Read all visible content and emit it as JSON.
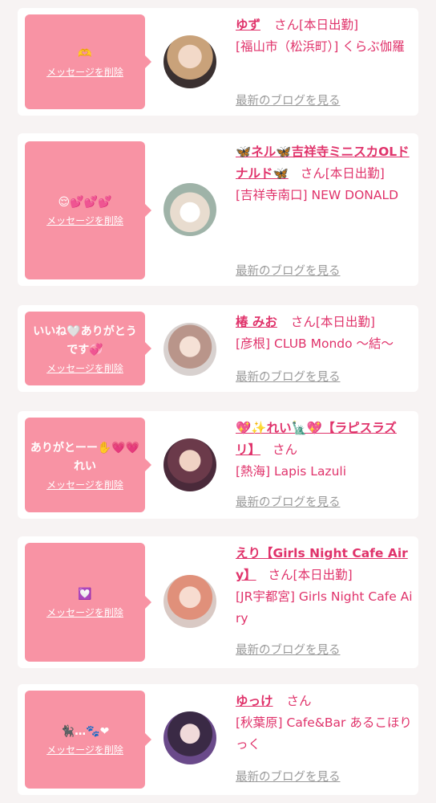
{
  "delete_label": "メッセージを削除",
  "blog_label": "最新のブログを見る",
  "items": [
    {
      "message": "🫶",
      "name": "ゆず",
      "suffix": "さん[本日出勤]",
      "shop": "[福山市（松浜町）] くらぶ伽羅"
    },
    {
      "message": "😌💕💕💕",
      "name": "🦋ネル🦋吉祥寺ミニスカOLドナルド🦋",
      "suffix": "さん[本日出勤]",
      "shop": "[吉祥寺南口] NEW DONALD"
    },
    {
      "message": "いいね🤍ありがとうです💞",
      "name": "椿 みお",
      "suffix": "さん[本日出勤]",
      "shop": "[彦根] CLUB Mondo 〜結〜"
    },
    {
      "message": "ありがとーー✋💗💗れい",
      "name": "💖✨れい🗽💖【ラピスラズリ】",
      "suffix": "さん",
      "shop": "[熱海] Lapis Lazuli"
    },
    {
      "message": "💟",
      "name": "えり【Girls Night Cafe Airy】",
      "suffix": "さん[本日出勤]",
      "shop": "[JR宇都宮] Girls Night Cafe Airy"
    },
    {
      "message": "🐈‍⬛…🐾❤",
      "name": "ゆっけ",
      "suffix": "さん",
      "shop": "[秋葉原] Cafe&Bar あるこほりっく"
    }
  ]
}
